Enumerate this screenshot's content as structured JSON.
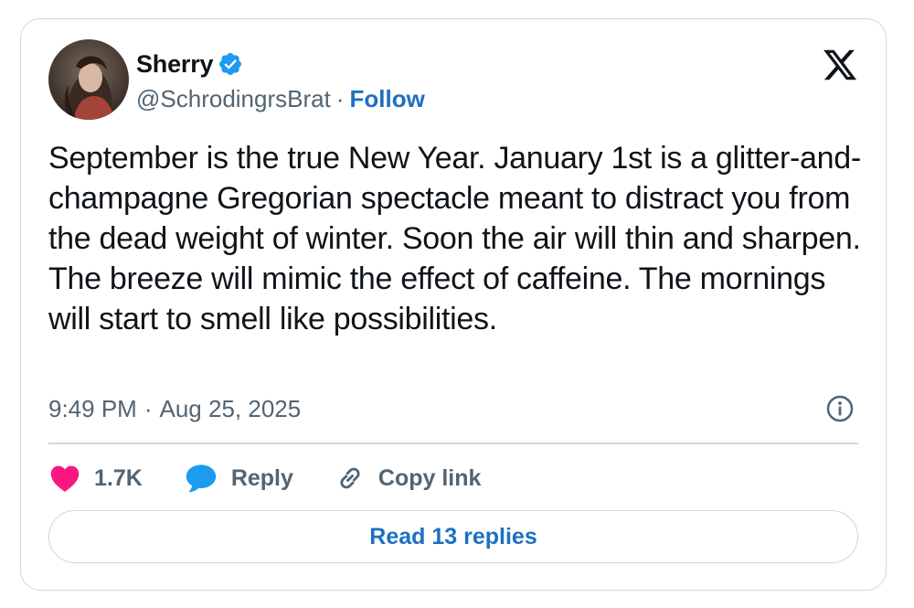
{
  "author": {
    "name": "Sherry",
    "handle": "@SchrodingrsBrat",
    "separator": "·",
    "follow_label": "Follow"
  },
  "tweet": {
    "text": "September is the true New Year. January 1st is a glitter-and-champagne Gregorian spectacle meant to distract you from the dead weight of winter. Soon the air will thin and sharpen. The breeze will mimic the effect of caffeine. The mornings will start to smell like possibilities.",
    "time": "9:49 PM",
    "separator": "·",
    "date": "Aug 25, 2025"
  },
  "actions": {
    "like_count": "1.7K",
    "reply_label": "Reply",
    "copy_link_label": "Copy link"
  },
  "read_replies_label": "Read 13 replies",
  "colors": {
    "accent": "#1d70c3",
    "like": "#f91880",
    "reply_icon": "#1d9bf0",
    "muted": "#536471",
    "border": "#cfd9de",
    "verified": "#1d9bf0"
  },
  "icons": {
    "verified": "verified-badge-icon",
    "logo": "x-logo-icon",
    "info": "info-icon",
    "like": "heart-icon",
    "reply": "speech-bubble-icon",
    "copy_link": "link-icon"
  }
}
